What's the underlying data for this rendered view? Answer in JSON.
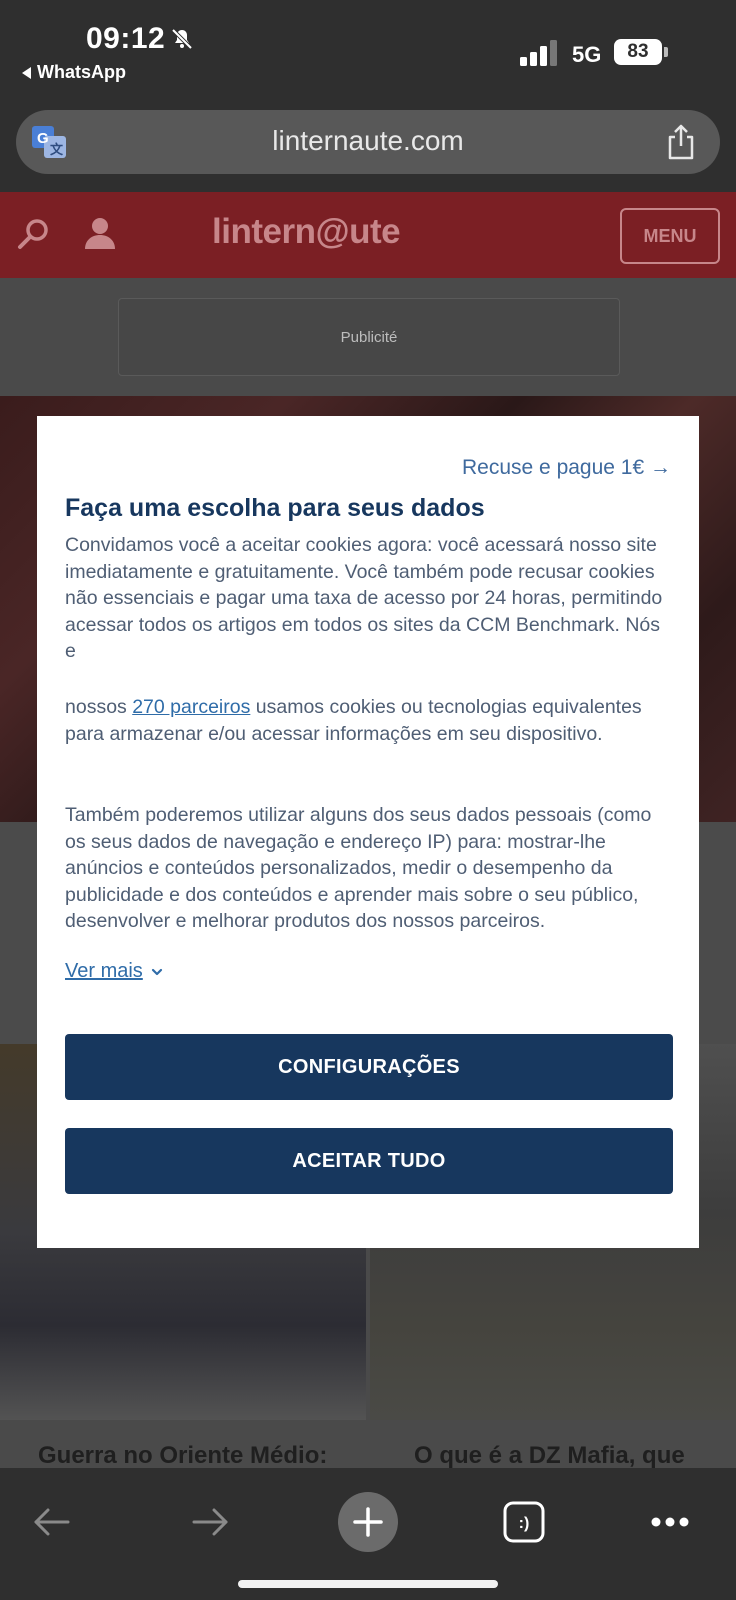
{
  "status_bar": {
    "time": "09:12",
    "back_app": "WhatsApp",
    "network": "5G",
    "battery": "83"
  },
  "browser": {
    "url": "linternaute.com"
  },
  "site": {
    "logo": "lintern@ute",
    "menu_label": "MENU",
    "ad_label": "Publicité",
    "headline_left": "Guerra no Oriente Médio:",
    "headline_right": "O que é a DZ Mafia, que"
  },
  "consent": {
    "refuse_link": "Recuse e pague 1€ →",
    "title": "Faça uma escolha para seus dados",
    "paragraph1": "Convidamos você a aceitar cookies agora: você acessará nosso site imediatamente e gratuitamente. Você também pode recusar cookies não essenciais e pagar uma taxa de acesso por 24 horas, permitindo acessar todos os artigos em todos os sites da CCM Benchmark. Nós e",
    "paragraph2_before": "nossos ",
    "partners_link": "270 parceiros",
    "paragraph2_after": " usamos cookies ou tecnologias equivalentes para armazenar e/ou acessar informações em seu dispositivo.",
    "paragraph3": "Também poderemos utilizar alguns dos seus dados pessoais (como os seus dados de navegação e endereço IP) para: mostrar-lhe anúncios e conteúdos personalizados, medir o desempenho da publicidade e dos conteúdos e aprender mais sobre o seu público, desenvolver e melhorar produtos dos nossos parceiros.",
    "see_more": "Ver mais",
    "settings_button": "CONFIGURAÇÕES",
    "accept_button": "ACEITAR TUDO"
  },
  "toolbar": {
    "tabs_icon_label": ":)"
  }
}
